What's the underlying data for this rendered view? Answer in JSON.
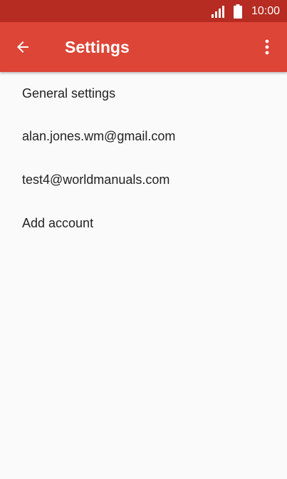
{
  "status_bar": {
    "time": "10:00",
    "icons": [
      "signal-icon",
      "battery-icon"
    ]
  },
  "app_bar": {
    "title": "Settings",
    "back_icon": "back-arrow-icon",
    "menu_icon": "more-vert-icon"
  },
  "settings_list": {
    "items": [
      {
        "label": "General settings"
      },
      {
        "label": "alan.jones.wm@gmail.com"
      },
      {
        "label": "test4@worldmanuals.com"
      },
      {
        "label": "Add account"
      }
    ]
  },
  "colors": {
    "status_bar": "#b62b22",
    "app_bar": "#dd4537",
    "background": "#fafafa",
    "text": "#222222"
  }
}
